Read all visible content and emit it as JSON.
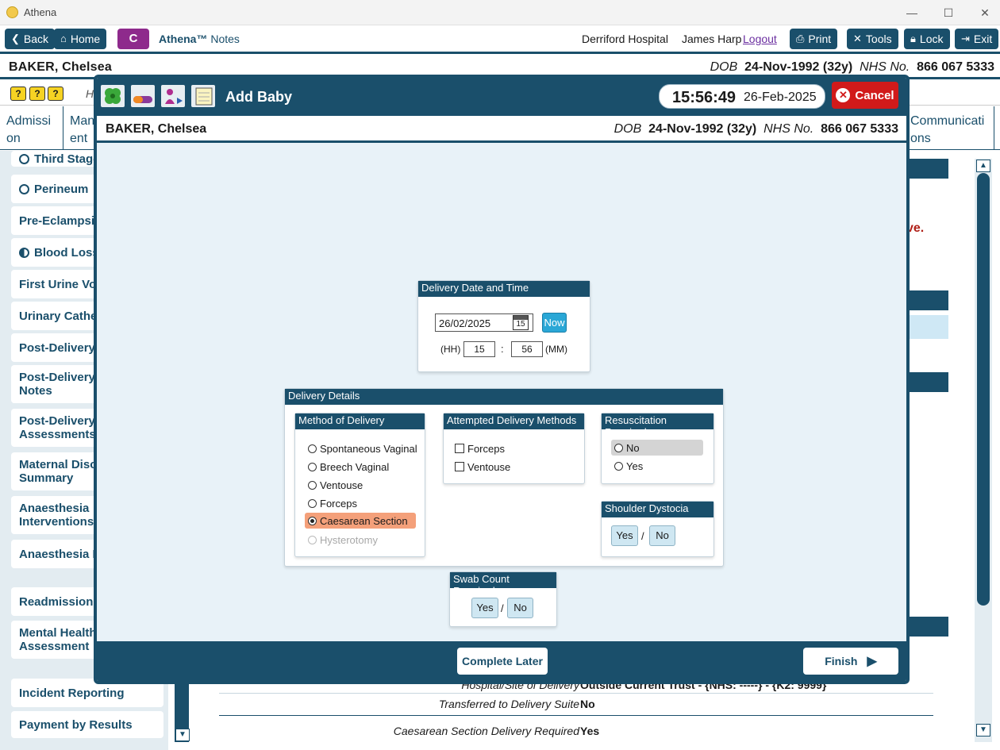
{
  "window": {
    "title": "Athena"
  },
  "appbar": {
    "back": "Back",
    "home": "Home",
    "c_label": "C",
    "brand_name": "Athena™",
    "brand_suffix": "Notes",
    "hospital": "Derriford Hospital",
    "user": "James Harp",
    "logout": "Logout",
    "print": "Print",
    "tools": "Tools",
    "lock": "Lock",
    "exit": "Exit"
  },
  "patient": {
    "name": "BAKER, Chelsea",
    "dob_label": "DOB",
    "dob": "24-Nov-1992 (32y)",
    "nhs_label": "NHS No.",
    "nhs": "866 067 5333"
  },
  "background": {
    "tabs": [
      "Admissi on",
      "Man ent",
      "Communicati ons"
    ],
    "toolbar_hint": "H",
    "sidebar": [
      "Third Stage",
      "Perineum",
      "Pre-Eclampsia",
      "Blood Loss",
      "First Urine Voi",
      "Urinary Cathe",
      "Post-Delivery",
      "Post-Delivery Notes",
      "Post-Delivery Assessments",
      "Maternal Disc Summary",
      "Anaesthesia Interventions",
      "Anaesthesia F",
      "Readmission F",
      "Mental Health Assessment",
      "Incident Reporting",
      "Payment by Results"
    ],
    "red_text": "ve.",
    "rows": [
      {
        "label": "Hospital/Site of Delivery",
        "value": "Outside Current Trust - {NHS: -----} - {K2: 9999}"
      },
      {
        "label": "Transferred to Delivery Suite",
        "value": "No"
      },
      {
        "label": "Caesarean Section Delivery Required",
        "value": "Yes"
      }
    ]
  },
  "modal": {
    "title": "Add Baby",
    "clock_time": "15:56:49",
    "clock_date": "26-Feb-2025",
    "cancel": "Cancel",
    "delivery_date": {
      "heading": "Delivery Date and Time",
      "date_value": "26/02/2025",
      "calendar_day": "15",
      "now_button": "Now",
      "hh_label": "(HH)",
      "hh_value": "15",
      "separator": ":",
      "mm_value": "56",
      "mm_label": "(MM)"
    },
    "details": {
      "heading": "Delivery Details",
      "method": {
        "heading": "Method of Delivery",
        "options": [
          "Spontaneous Vaginal",
          "Breech Vaginal",
          "Ventouse",
          "Forceps",
          "Caesarean Section",
          "Hysterotomy"
        ],
        "selected": "Caesarean Section",
        "disabled": "Hysterotomy"
      },
      "attempted": {
        "heading": "Attempted Delivery Methods",
        "options": [
          "Forceps",
          "Ventouse"
        ]
      },
      "resus": {
        "heading": "Resuscitation Required",
        "options": [
          "No",
          "Yes"
        ]
      },
      "shoulder": {
        "heading": "Shoulder Dystocia",
        "yes": "Yes",
        "sep": "/",
        "no": "No"
      }
    },
    "swab": {
      "heading": "Swab Count Required",
      "yes": "Yes",
      "sep": "/",
      "no": "No"
    },
    "complete_later": "Complete Later",
    "finish": "Finish"
  },
  "colors": {
    "primary": "#1a4f6b",
    "accent_selected": "#f4a07a",
    "cancel": "#d11a1a",
    "now_button": "#2aa7d6"
  }
}
